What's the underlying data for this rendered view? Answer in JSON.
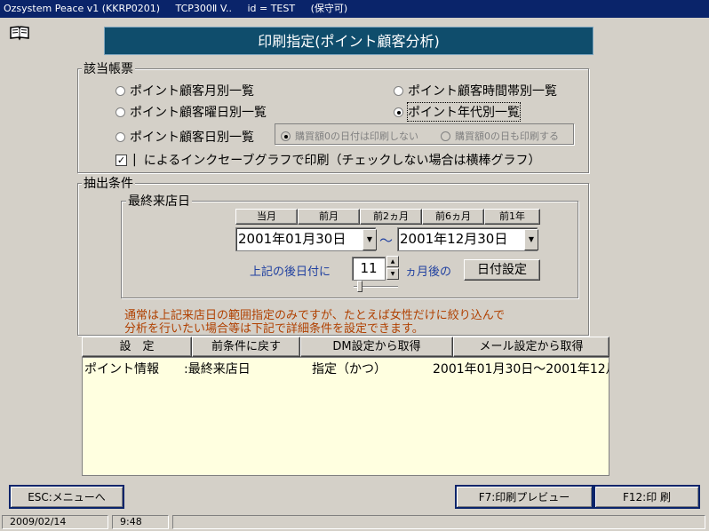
{
  "window": {
    "title_parts": [
      "Ozsystem Peace v1 (KKRP0201)",
      "TCP300Ⅱ V..",
      "id = TEST",
      "(保守可)"
    ]
  },
  "header": {
    "title": "印刷指定(ポイント顧客分析)"
  },
  "report_group": {
    "title": "該当帳票",
    "options": [
      {
        "label": "ポイント顧客月別一覧",
        "selected": false
      },
      {
        "label": "ポイント顧客時間帯別一覧",
        "selected": false
      },
      {
        "label": "ポイント顧客曜日別一覧",
        "selected": false
      },
      {
        "label": "ポイント年代別一覧",
        "selected": true
      },
      {
        "label": "ポイント顧客日別一覧",
        "selected": false
      }
    ],
    "sub_options": [
      {
        "label": "購買額0の日付は印刷しない",
        "selected": true
      },
      {
        "label": "購買額0の日も印刷する",
        "selected": false
      }
    ],
    "graph_checkbox": {
      "checked": true,
      "mark": "✓",
      "label": "によるインクセーブグラフで印刷（チェックしない場合は横棒グラフ）"
    }
  },
  "extract_group": {
    "title": "抽出条件",
    "last_visit": {
      "title": "最終来店日",
      "tabs": [
        "当月",
        "前月",
        "前2ヵ月",
        "前6ヵ月",
        "前1年"
      ],
      "from_date": "2001年01月30日",
      "range_sep": "～",
      "to_date": "2001年12月30日",
      "after_label": "上記の後日付に",
      "months_value": "11",
      "months_suffix": "ヵ月後の",
      "set_date_button": "日付設定"
    },
    "note_lines": [
      "通常は上記来店日の範囲指定のみですが、たとえば女性だけに絞り込んで",
      "分析を行いたい場合等は下記で詳細条件を設定できます。"
    ]
  },
  "grid": {
    "headers": [
      "設　定",
      "前条件に戻す",
      "DM設定から取得",
      "メール設定から取得"
    ],
    "rows": [
      {
        "c1": "ポイント情報",
        "c2": ":最終来店日",
        "c3": "指定（かつ）",
        "c4": "2001年01月30日～2001年12月"
      }
    ]
  },
  "footer": {
    "esc_button": "ESC:メニューへ",
    "f7_button": "F7:印刷プレビュー",
    "f12_button": "F12:印 刷"
  },
  "status": {
    "date": "2009/02/14",
    "time": "9:48"
  }
}
